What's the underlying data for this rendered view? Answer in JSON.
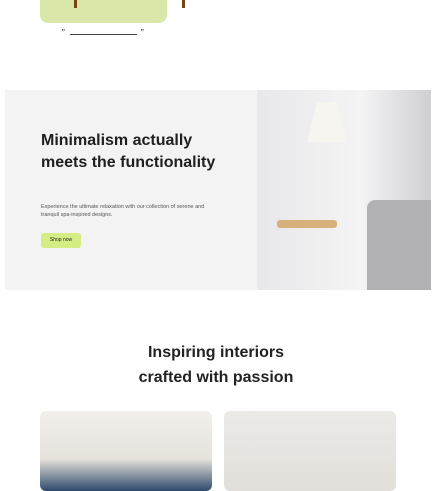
{
  "hero": {
    "title": "Minimalism actually meets the functionality",
    "description": "Experience the ultimate relaxation with our collection of serene and tranquil spa-inspired designs.",
    "button_label": "Shop now"
  },
  "section": {
    "title_line1": "Inspiring interiors",
    "title_line2": "crafted with passion"
  },
  "quote": {
    "open": "”",
    "close": "”"
  },
  "colors": {
    "accent": "#d4ee84",
    "card_green": "#d9e8a8",
    "hero_bg": "#f3f3f3"
  }
}
